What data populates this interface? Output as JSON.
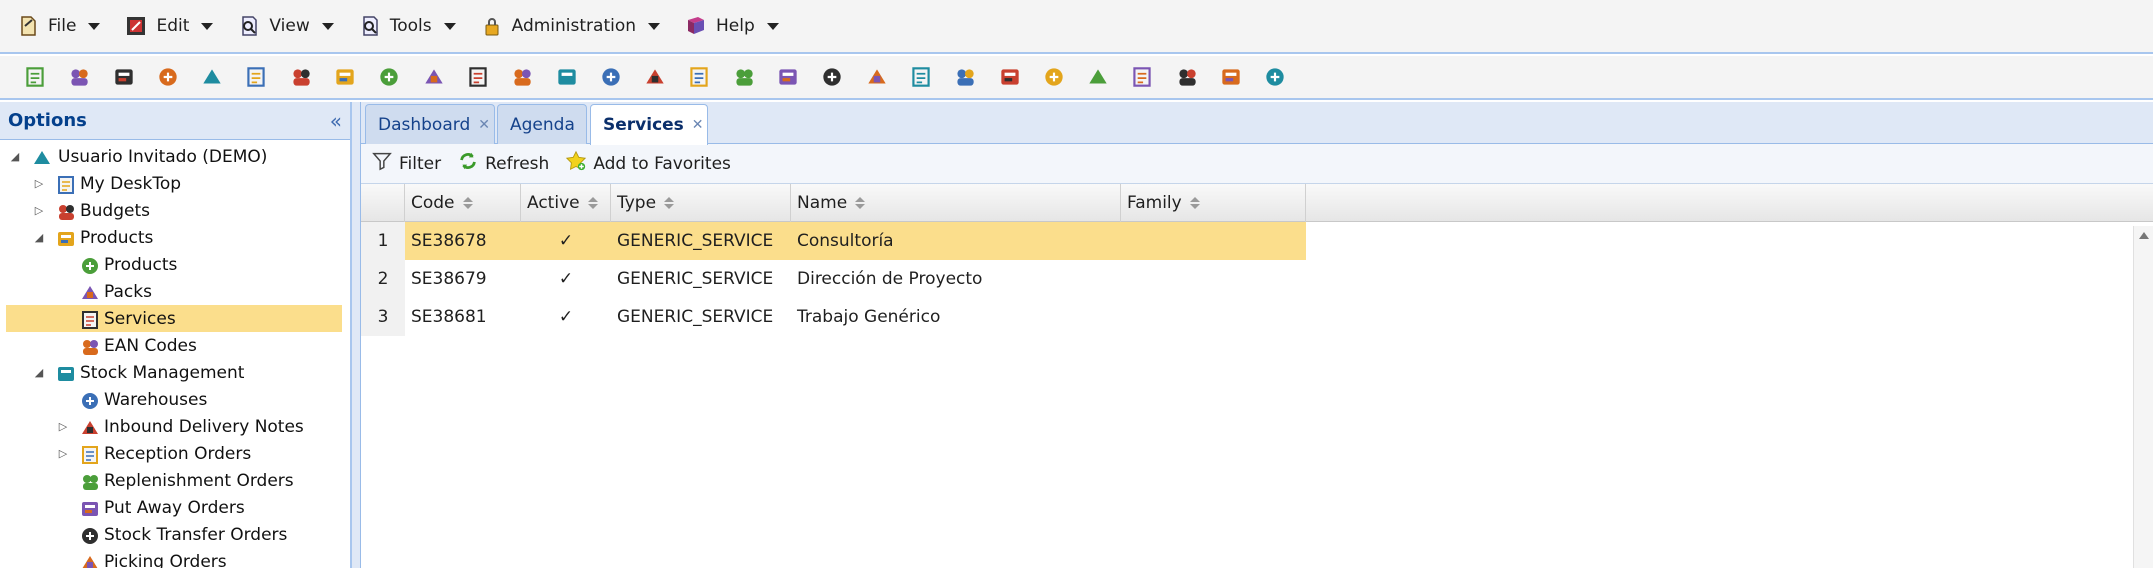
{
  "menubar": [
    {
      "label": "File",
      "icon": "file-icon"
    },
    {
      "label": "Edit",
      "icon": "edit-icon"
    },
    {
      "label": "View",
      "icon": "view-icon"
    },
    {
      "label": "Tools",
      "icon": "tools-icon"
    },
    {
      "label": "Administration",
      "icon": "lock-icon"
    },
    {
      "label": "Help",
      "icon": "help-book-icon"
    }
  ],
  "toolbar_icons": [
    "print-icon",
    "cut-icon",
    "copy-icon",
    "paste-icon",
    "calendar-icon",
    "document-icon",
    "cash-register-icon",
    "box-icon",
    "people-icon",
    "warehouse-icon",
    "truck-icon",
    "package-icon",
    "card-icon",
    "pencil-check-icon",
    "pencil-check-icon-2",
    "fire-icon",
    "user-tie-icon",
    "calculator-icon",
    "puzzle-icon",
    "money-doc-icon",
    "money-doc-icon-2",
    "house-icon",
    "person-icon",
    "contacts-icon",
    "mail-icon",
    "report-icon",
    "bug-icon",
    "cart-icon",
    "list-icon"
  ],
  "left_panel": {
    "title": "Options",
    "tree": [
      {
        "label": "Usuario Invitado (DEMO)",
        "level": 0,
        "expander": "open",
        "icon": "computer-user-icon"
      },
      {
        "label": "My DeskTop",
        "level": 1,
        "expander": "closed",
        "icon": "desktop-icon"
      },
      {
        "label": "Budgets",
        "level": 1,
        "expander": "closed",
        "icon": "budget-icon"
      },
      {
        "label": "Products",
        "level": 1,
        "expander": "open",
        "icon": "products-pyramid-icon"
      },
      {
        "label": "Products",
        "level": 2,
        "expander": "none",
        "icon": "product-box-icon"
      },
      {
        "label": "Packs",
        "level": 2,
        "expander": "none",
        "icon": "packs-icon"
      },
      {
        "label": "Services",
        "level": 2,
        "expander": "none",
        "icon": "services-people-icon",
        "selected": true
      },
      {
        "label": "EAN Codes",
        "level": 2,
        "expander": "none",
        "icon": "barcode-icon"
      },
      {
        "label": "Stock Management",
        "level": 1,
        "expander": "open",
        "icon": "stock-icon"
      },
      {
        "label": "Warehouses",
        "level": 2,
        "expander": "none",
        "icon": "warehouse-icon"
      },
      {
        "label": "Inbound Delivery Notes",
        "level": 2,
        "expander": "closed",
        "icon": "inbound-icon"
      },
      {
        "label": "Reception Orders",
        "level": 2,
        "expander": "closed",
        "icon": "reception-icon"
      },
      {
        "label": "Replenishment Orders",
        "level": 2,
        "expander": "none",
        "icon": "replenish-icon"
      },
      {
        "label": "Put Away Orders",
        "level": 2,
        "expander": "none",
        "icon": "putaway-icon"
      },
      {
        "label": "Stock Transfer Orders",
        "level": 2,
        "expander": "none",
        "icon": "transfer-icon"
      },
      {
        "label": "Picking Orders",
        "level": 2,
        "expander": "none",
        "icon": "picking-icon"
      }
    ]
  },
  "tabs": [
    {
      "label": "Dashboard",
      "closable": true,
      "active": false
    },
    {
      "label": "Agenda",
      "closable": false,
      "active": false
    },
    {
      "label": "Services",
      "closable": true,
      "active": true
    }
  ],
  "actions": [
    {
      "label": "Filter",
      "icon": "filter-icon"
    },
    {
      "label": "Refresh",
      "icon": "refresh-icon"
    },
    {
      "label": "Add to Favorites",
      "icon": "star-add-icon"
    }
  ],
  "grid": {
    "columns": [
      "Code",
      "Active",
      "Type",
      "Name",
      "Family"
    ],
    "rows": [
      {
        "num": "1",
        "code": "SE38678",
        "active": "✓",
        "type": "GENERIC_SERVICE",
        "name": "Consultoría",
        "family": "",
        "selected": true
      },
      {
        "num": "2",
        "code": "SE38679",
        "active": "✓",
        "type": "GENERIC_SERVICE",
        "name": "Dirección de Proyecto",
        "family": ""
      },
      {
        "num": "3",
        "code": "SE38681",
        "active": "✓",
        "type": "GENERIC_SERVICE",
        "name": "Trabajo Genérico",
        "family": ""
      }
    ]
  },
  "colors": {
    "accent": "#04408c",
    "selection": "#fbde8c",
    "panel_header": "#dfe8f6"
  }
}
